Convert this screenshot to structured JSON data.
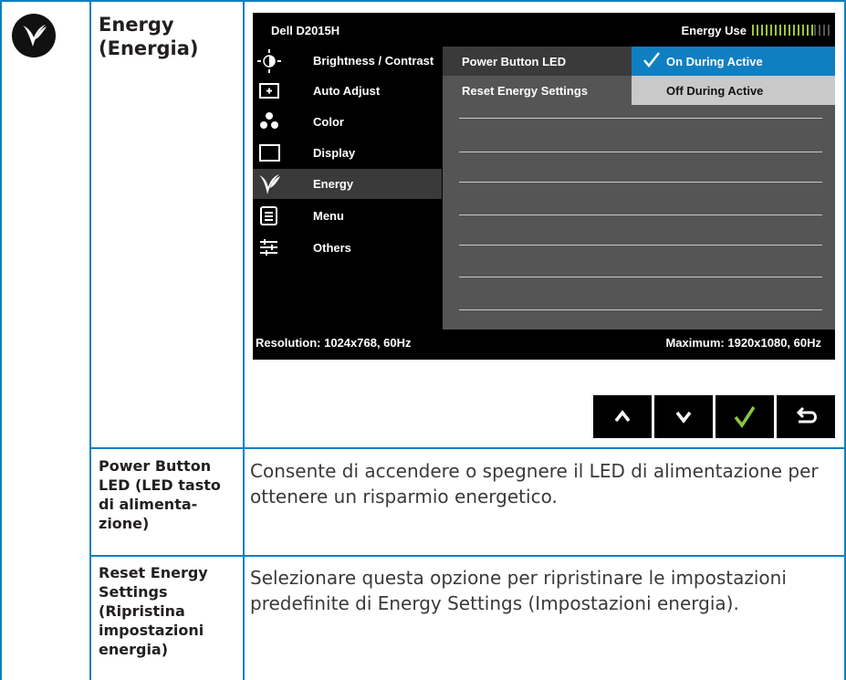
{
  "section": {
    "title_line1": "Energy",
    "title_line2": "(Energia)",
    "icon": "energy-leaf-icon"
  },
  "osd": {
    "model": "Dell D2015H",
    "energy_use_label": "Energy Use",
    "menu": [
      {
        "label": "Brightness / Contrast",
        "icon": "brightness-icon"
      },
      {
        "label": "Auto Adjust",
        "icon": "auto-adjust-icon"
      },
      {
        "label": "Color",
        "icon": "color-icon"
      },
      {
        "label": "Display",
        "icon": "display-icon"
      },
      {
        "label": "Energy",
        "icon": "energy-leaf-icon"
      },
      {
        "label": "Menu",
        "icon": "menu-icon"
      },
      {
        "label": "Others",
        "icon": "others-sliders-icon"
      }
    ],
    "active_menu": "Energy",
    "submenu": [
      {
        "label": "Power Button LED"
      },
      {
        "label": "Reset Energy Settings"
      }
    ],
    "options": {
      "selected": "On During Active",
      "other": "Off During Active"
    },
    "resolution": "Resolution: 1024x768, 60Hz",
    "maximum": "Maximum: 1920x1080, 60Hz",
    "accent": "#0f7fc1",
    "meter_color": "#9fc63b"
  },
  "nav_buttons": [
    {
      "icon": "chevron-up-icon"
    },
    {
      "icon": "chevron-down-icon"
    },
    {
      "icon": "check-icon"
    },
    {
      "icon": "back-return-icon"
    }
  ],
  "rows": [
    {
      "label_lines": [
        "Power Button",
        "LED (LED tasto",
        "di alimenta-",
        "zione)"
      ],
      "description": "Consente di accendere o spegnere il LED di alimentazione per ottenere un risparmio energetico."
    },
    {
      "label_lines": [
        "Reset Energy",
        "Settings",
        "(Ripristina",
        "impostazioni",
        "energia)"
      ],
      "description": "Selezionare questa opzione per ripristinare le impostazioni predefinite di Energy Settings (Impostazioni energia)."
    }
  ]
}
